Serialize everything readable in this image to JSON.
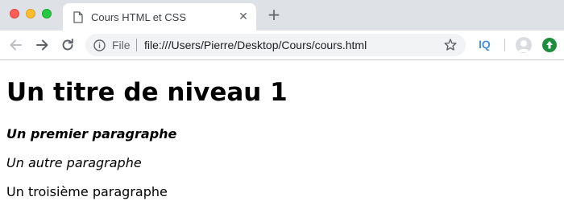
{
  "window": {
    "traffic_lights": {
      "close_color": "#ff5f57",
      "minimize_color": "#febc2e",
      "maximize_color": "#28c840"
    }
  },
  "tab": {
    "title": "Cours HTML et CSS",
    "close_glyph": "✕",
    "icon": "page-icon"
  },
  "new_tab": {
    "glyph": "+"
  },
  "toolbar": {
    "back_icon": "arrow-left-icon",
    "forward_icon": "arrow-right-icon",
    "reload_icon": "reload-icon"
  },
  "omnibox": {
    "scheme_label": "File",
    "url": "file:///Users/Pierre/Desktop/Cours/cours.html",
    "bookmark_icon": "star-icon"
  },
  "extensions": {
    "iq_label": "IQ",
    "iq_color": "#4a90d9",
    "update_color": "#1e8e3e"
  },
  "page": {
    "heading": "Un titre de niveau 1",
    "paragraphs": [
      "Un premier paragraphe",
      "Un autre paragraphe",
      "Un troisième paragraphe"
    ]
  }
}
